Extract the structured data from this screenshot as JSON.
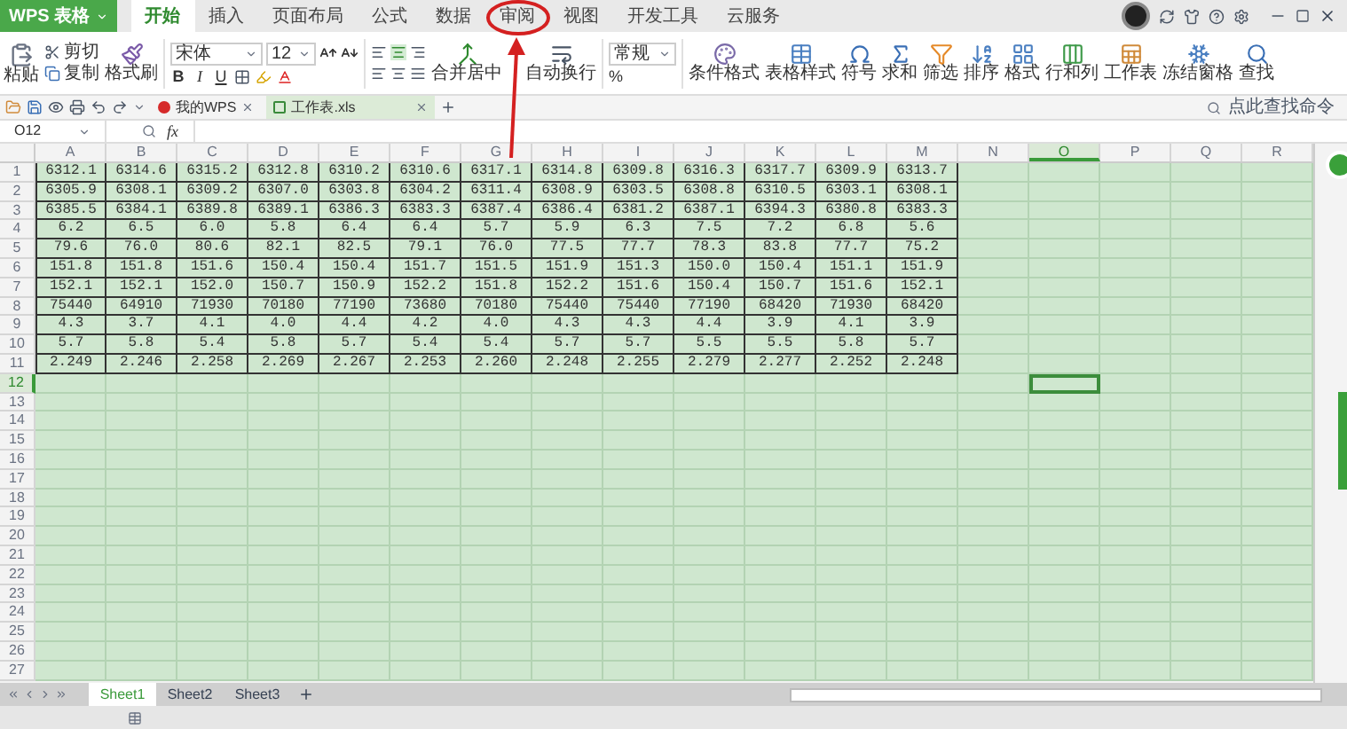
{
  "menu": {
    "app": "WPS 表格",
    "tabs": [
      {
        "label": "开始",
        "selected": true
      },
      {
        "label": "插入",
        "selected": false
      },
      {
        "label": "页面布局",
        "selected": false
      },
      {
        "label": "公式",
        "selected": false
      },
      {
        "label": "数据",
        "selected": false
      },
      {
        "label": "审阅",
        "selected": false
      },
      {
        "label": "视图",
        "selected": false
      },
      {
        "label": "开发工具",
        "selected": false
      },
      {
        "label": "云服务",
        "selected": false
      }
    ]
  },
  "ribbon": {
    "paste": "粘贴",
    "cut": "剪切",
    "copy": "复制",
    "format_painter": "格式刷",
    "font": "宋体",
    "font_size": "12",
    "styles": [
      "B",
      "I",
      "U"
    ],
    "merge": "合并居中",
    "wrap": "自动换行",
    "number_format": "常规",
    "percent": "%",
    "tools": [
      {
        "label": "条件格式"
      },
      {
        "label": "表格样式"
      },
      {
        "label": "符号"
      },
      {
        "label": "求和"
      },
      {
        "label": "筛选"
      },
      {
        "label": "排序"
      },
      {
        "label": "格式"
      },
      {
        "label": "行和列"
      },
      {
        "label": "工作表"
      },
      {
        "label": "冻结窗格"
      },
      {
        "label": "查找"
      }
    ]
  },
  "doc_tabs": [
    {
      "label": "我的WPS",
      "selected": false
    },
    {
      "label": "工作表.xls",
      "selected": true
    }
  ],
  "command_search": "点此查找命令",
  "formula_bar": {
    "name_box": "O12",
    "fx": "fx"
  },
  "grid": {
    "columns": [
      {
        "label": "A",
        "selected": false
      },
      {
        "label": "B",
        "selected": false
      },
      {
        "label": "C",
        "selected": false
      },
      {
        "label": "D",
        "selected": false
      },
      {
        "label": "E",
        "selected": false
      },
      {
        "label": "F",
        "selected": false
      },
      {
        "label": "G",
        "selected": false
      },
      {
        "label": "H",
        "selected": false
      },
      {
        "label": "I",
        "selected": false
      },
      {
        "label": "J",
        "selected": false
      },
      {
        "label": "K",
        "selected": false
      },
      {
        "label": "L",
        "selected": false
      },
      {
        "label": "M",
        "selected": false
      },
      {
        "label": "N",
        "selected": false
      },
      {
        "label": "O",
        "selected": true
      },
      {
        "label": "P",
        "selected": false
      },
      {
        "label": "Q",
        "selected": false
      },
      {
        "label": "R",
        "selected": false
      }
    ],
    "row_numbers": [
      {
        "label": "1",
        "selected": false
      },
      {
        "label": "2",
        "selected": false
      },
      {
        "label": "3",
        "selected": false
      },
      {
        "label": "4",
        "selected": false
      },
      {
        "label": "5",
        "selected": false
      },
      {
        "label": "6",
        "selected": false
      },
      {
        "label": "7",
        "selected": false
      },
      {
        "label": "8",
        "selected": false
      },
      {
        "label": "9",
        "selected": false
      },
      {
        "label": "10",
        "selected": false
      },
      {
        "label": "11",
        "selected": false
      },
      {
        "label": "12",
        "selected": true
      },
      {
        "label": "13",
        "selected": false
      },
      {
        "label": "14",
        "selected": false
      },
      {
        "label": "15",
        "selected": false
      },
      {
        "label": "16",
        "selected": false
      },
      {
        "label": "17",
        "selected": false
      },
      {
        "label": "18",
        "selected": false
      },
      {
        "label": "19",
        "selected": false
      },
      {
        "label": "20",
        "selected": false
      },
      {
        "label": "21",
        "selected": false
      },
      {
        "label": "22",
        "selected": false
      },
      {
        "label": "23",
        "selected": false
      },
      {
        "label": "24",
        "selected": false
      },
      {
        "label": "25",
        "selected": false
      },
      {
        "label": "26",
        "selected": false
      },
      {
        "label": "27",
        "selected": false
      }
    ],
    "rows": [
      [
        "6312.1",
        "6314.6",
        "6315.2",
        "6312.8",
        "6310.2",
        "6310.6",
        "6317.1",
        "6314.8",
        "6309.8",
        "6316.3",
        "6317.7",
        "6309.9",
        "6313.7"
      ],
      [
        "6305.9",
        "6308.1",
        "6309.2",
        "6307.0",
        "6303.8",
        "6304.2",
        "6311.4",
        "6308.9",
        "6303.5",
        "6308.8",
        "6310.5",
        "6303.1",
        "6308.1"
      ],
      [
        "6385.5",
        "6384.1",
        "6389.8",
        "6389.1",
        "6386.3",
        "6383.3",
        "6387.4",
        "6386.4",
        "6381.2",
        "6387.1",
        "6394.3",
        "6380.8",
        "6383.3"
      ],
      [
        "6.2",
        "6.5",
        "6.0",
        "5.8",
        "6.4",
        "6.4",
        "5.7",
        "5.9",
        "6.3",
        "7.5",
        "7.2",
        "6.8",
        "5.6"
      ],
      [
        "79.6",
        "76.0",
        "80.6",
        "82.1",
        "82.5",
        "79.1",
        "76.0",
        "77.5",
        "77.7",
        "78.3",
        "83.8",
        "77.7",
        "75.2"
      ],
      [
        "151.8",
        "151.8",
        "151.6",
        "150.4",
        "150.4",
        "151.7",
        "151.5",
        "151.9",
        "151.3",
        "150.0",
        "150.4",
        "151.1",
        "151.9"
      ],
      [
        "152.1",
        "152.1",
        "152.0",
        "150.7",
        "150.9",
        "152.2",
        "151.8",
        "152.2",
        "151.6",
        "150.4",
        "150.7",
        "151.6",
        "152.1"
      ],
      [
        "75440",
        "64910",
        "71930",
        "70180",
        "77190",
        "73680",
        "70180",
        "75440",
        "75440",
        "77190",
        "68420",
        "71930",
        "68420"
      ],
      [
        "4.3",
        "3.7",
        "4.1",
        "4.0",
        "4.4",
        "4.2",
        "4.0",
        "4.3",
        "4.3",
        "4.4",
        "3.9",
        "4.1",
        "3.9"
      ],
      [
        "5.7",
        "5.8",
        "5.4",
        "5.8",
        "5.7",
        "5.4",
        "5.4",
        "5.7",
        "5.7",
        "5.5",
        "5.5",
        "5.8",
        "5.7"
      ],
      [
        "2.249",
        "2.246",
        "2.258",
        "2.269",
        "2.267",
        "2.253",
        "2.260",
        "2.248",
        "2.255",
        "2.279",
        "2.277",
        "2.252",
        "2.248"
      ]
    ]
  },
  "sheets": [
    {
      "label": "Sheet1",
      "selected": true
    },
    {
      "label": "Sheet2",
      "selected": false
    },
    {
      "label": "Sheet3",
      "selected": false
    }
  ]
}
